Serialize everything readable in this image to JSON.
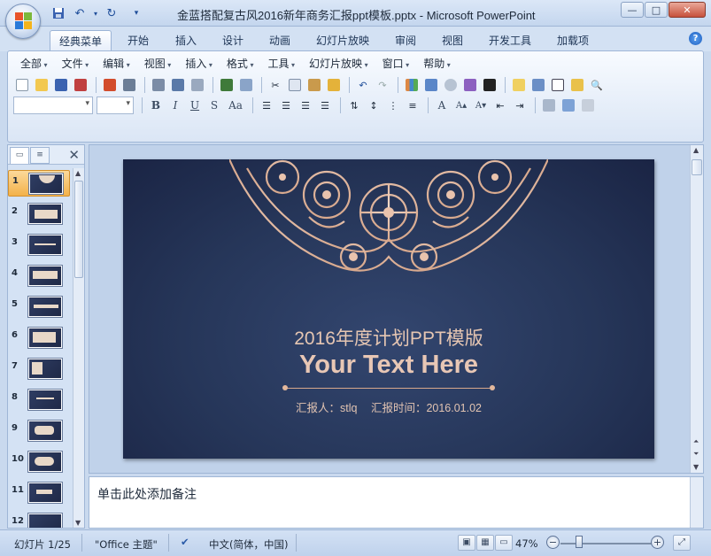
{
  "window": {
    "title": "金蓝搭配复古风2016新年商务汇报ppt模板.pptx - Microsoft PowerPoint",
    "minimize": "—",
    "maximize": "□",
    "close": "✕"
  },
  "qat": [
    "save-icon",
    "undo-icon",
    "redo-icon",
    "customize-icon"
  ],
  "tabs": [
    {
      "label": "经典菜单",
      "active": true
    },
    {
      "label": "开始"
    },
    {
      "label": "插入"
    },
    {
      "label": "设计"
    },
    {
      "label": "动画"
    },
    {
      "label": "幻灯片放映"
    },
    {
      "label": "审阅"
    },
    {
      "label": "视图"
    },
    {
      "label": "开发工具"
    },
    {
      "label": "加载项"
    }
  ],
  "menus": [
    "全部",
    "文件",
    "编辑",
    "视图",
    "插入",
    "格式",
    "工具",
    "幻灯片放映",
    "窗口",
    "帮助"
  ],
  "format": {
    "bold": "B",
    "italic": "I",
    "underline": "U",
    "shadow": "S",
    "case": "Aa",
    "fontcolor": "A"
  },
  "panel_tabs": {
    "close": "✕"
  },
  "slides_count": 12,
  "slide_numbers": [
    "1",
    "2",
    "3",
    "4",
    "5",
    "6",
    "7",
    "8",
    "9",
    "10",
    "11",
    "12"
  ],
  "slide": {
    "subtitle": "2016年度计划PPT模版",
    "headline": "Your Text Here",
    "reporter": "汇报人：stlq",
    "report_time": "汇报时间：2016.01.02"
  },
  "notes_placeholder": "单击此处添加备注",
  "status": {
    "slide_info": "幻灯片 1/25",
    "theme": "\"Office 主题\"",
    "language": "中文(简体，中国)",
    "zoom": "47%",
    "zoom_out": "−",
    "zoom_in": "+"
  },
  "colors": {
    "slide_bg": "#263659",
    "accent": "#e8c7b5",
    "selected_thumb": "#f3b24a"
  }
}
